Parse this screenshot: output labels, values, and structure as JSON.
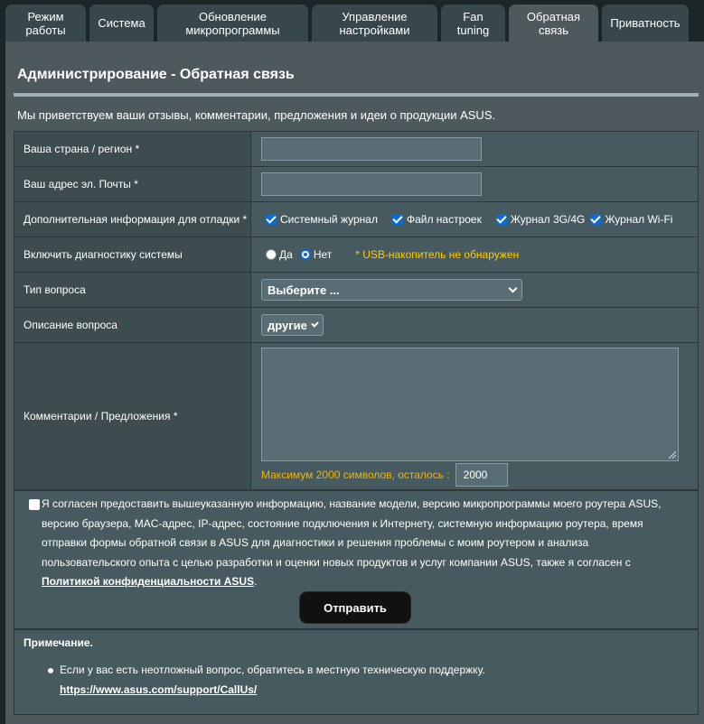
{
  "tabs": [
    {
      "label": "Режим\nработы"
    },
    {
      "label": "Система"
    },
    {
      "label": "Обновление\nмикропрограммы"
    },
    {
      "label": "Управление\nнастройками"
    },
    {
      "label": "Fan\ntuning"
    },
    {
      "label": "Обратная\nсвязь"
    },
    {
      "label": "Приватность"
    }
  ],
  "page": {
    "title": "Администрирование - Обратная связь",
    "welcome": "Мы приветствуем ваши отзывы, комментарии, предложения и идеи о продукции ASUS."
  },
  "form": {
    "country_label": "Ваша страна / регион *",
    "country_value": "",
    "email_label": "Ваш адрес эл. Почты *",
    "email_value": "",
    "debug_label": "Дополнительная информация для отладки *",
    "debug_options": [
      {
        "label": "Системный журнал",
        "checked": true
      },
      {
        "label": "Файл настроек",
        "checked": true
      },
      {
        "label": "Журнал 3G/4G",
        "checked": true
      },
      {
        "label": "Журнал Wi-Fi",
        "checked": true
      }
    ],
    "diag_label": "Включить диагностику системы",
    "diag_yes": "Да",
    "diag_no": "Нет",
    "diag_selected": "no",
    "usb_warning": "* USB-накопитель не обнаружен",
    "question_type_label": "Тип вопроса",
    "question_type_value": "Выберите ...",
    "question_desc_label": "Описание вопроса",
    "question_desc_value": "другие",
    "comments_label": "Комментарии / Предложения *",
    "comments_value": "",
    "max_chars_label": "Максимум 2000 символов, осталось :",
    "max_chars_remaining": "2000"
  },
  "consent": {
    "checked": false,
    "text": "Я согласен предоставить вышеуказанную информацию, название модели, версию микропрограммы моего роутера ASUS, версию браузера, MAC-адрес, IP-адрес, состояние подключения к Интернету, системную информацию роутера, время отправки формы обратной связи в ASUS для диагностики и решения проблемы с моим роутером и анализа пользовательского опыта с целью разработки и оценки новых продуктов и услуг компании ASUS, также я согласен с ",
    "link_text": "Политикой конфиденциальности ASUS",
    "after_link": ".",
    "submit_label": "Отправить"
  },
  "note": {
    "title": "Примечание.",
    "text": "Если у вас есть неотложный вопрос, обратитесь в местную техническую поддержку.",
    "link": "https://www.asus.com/support/CallUs/"
  },
  "colors": {
    "panel": "#4d595d",
    "tab": "#38474b",
    "cell": "#475a5f",
    "accent": "#0c6bd4",
    "warning": "#ffcc00"
  }
}
